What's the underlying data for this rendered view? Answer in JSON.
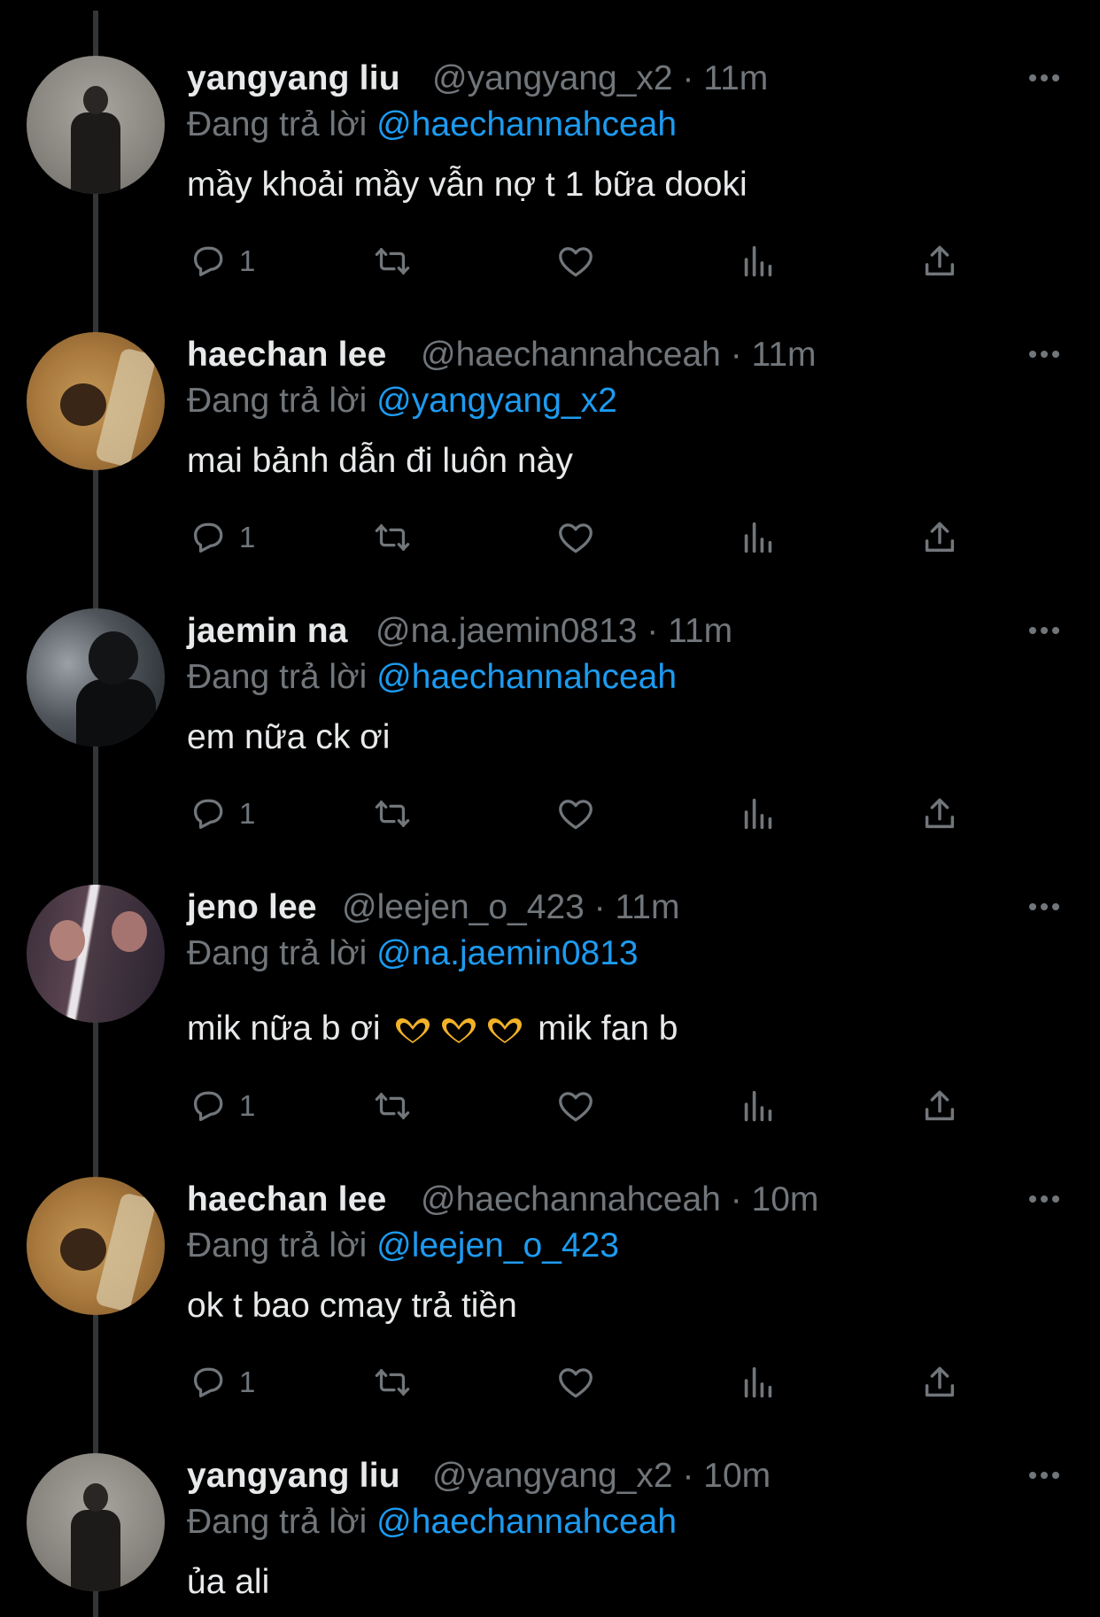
{
  "reply_prefix": "Đang trả lời",
  "tweets": [
    {
      "author": "yangyang liu",
      "handle": "@yangyang_x2",
      "time": "· 11m",
      "reply_to": "@haechannahceah",
      "text": "mầy khoải mầy vẫn nợ t 1 bữa dooki",
      "reply_count": "1",
      "avatar": "yangyang"
    },
    {
      "author": "haechan lee",
      "handle": "@haechannahceah",
      "time": "· 11m",
      "reply_to": "@yangyang_x2",
      "text": "mai bảnh dẫn đi luôn này",
      "reply_count": "1",
      "avatar": "haechan"
    },
    {
      "author": "jaemin na",
      "handle": "@na.jaemin0813",
      "time": "· 11m",
      "reply_to": "@haechannahceah",
      "text": "em nữa ck ơi",
      "reply_count": "1",
      "avatar": "jaemin"
    },
    {
      "author": "jeno lee",
      "handle": "@leejen_o_423",
      "time": "· 11m",
      "reply_to": "@na.jaemin0813",
      "text_before": "mik nữa b ơi",
      "text_after": " mik fan b",
      "emoji": "heart-hands",
      "reply_count": "1",
      "avatar": "jeno"
    },
    {
      "author": "haechan lee",
      "handle": "@haechannahceah",
      "time": "· 10m",
      "reply_to": "@leejen_o_423",
      "text": "ok t bao cmay trả tiền",
      "reply_count": "1",
      "avatar": "haechan"
    },
    {
      "author": "yangyang liu",
      "handle": "@yangyang_x2",
      "time": "· 10m",
      "reply_to": "@haechannahceah",
      "text": "ủa ali",
      "avatar": "yangyang"
    }
  ],
  "colors": {
    "background": "#000000",
    "primary_text": "#e7e9ea",
    "secondary_text": "#71767b",
    "mention": "#1d9bf0"
  }
}
